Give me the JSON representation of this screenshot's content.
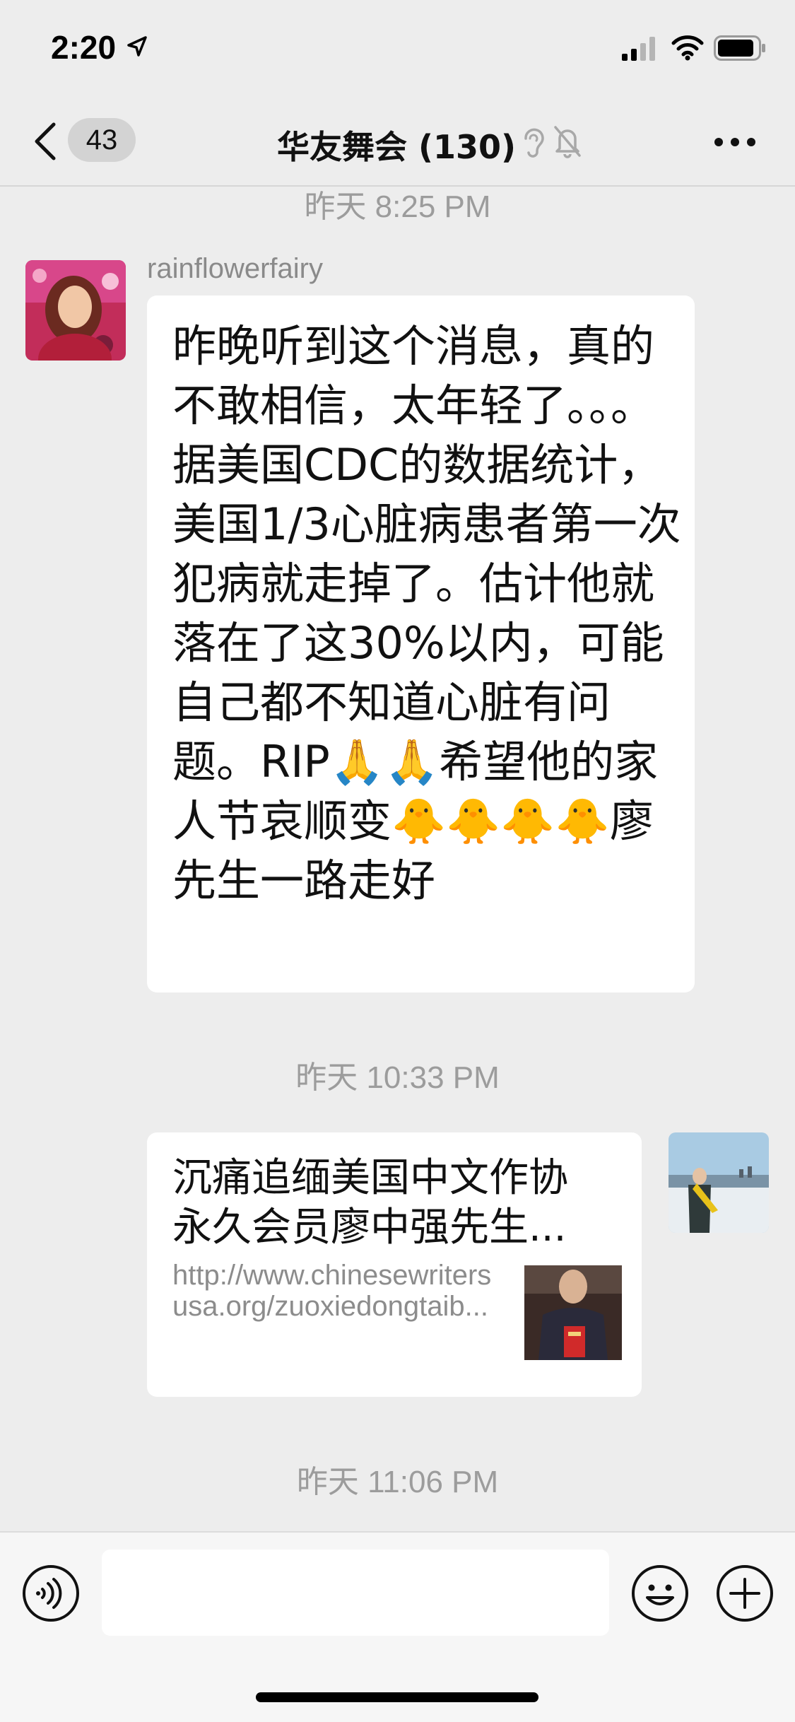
{
  "status_bar": {
    "time": "2:20"
  },
  "nav": {
    "unread_count": "43",
    "title": "华友舞会 (130)"
  },
  "messages": {
    "timestamp_1": "昨天 8:25 PM",
    "sender_name": "rainflowerfairy",
    "text_1": "昨晚听到这个消息，真的不敢相信，太年轻了。。。据美国CDC的数据统计，美国1/3心脏病患者第一次犯病就走掉了。估计他就落在了这30%以内，可能自己都不知道心脏有问题。RIP🙏🙏希望他的家人节哀顺变🐥🐥🐥🐥廖先生一路走好",
    "timestamp_2": "昨天 10:33 PM",
    "link_title": "沉痛追缅美国中文作协永久会员廖中强先生...",
    "link_url": "http://www.chinesewritersusa.org/zuoxiedongtaib...",
    "timestamp_3": "昨天 11:06 PM"
  },
  "colors": {
    "background": "#ededed",
    "bubble": "#ffffff",
    "timestamp": "#9c9c9c",
    "badge": "#d3d3d3"
  }
}
